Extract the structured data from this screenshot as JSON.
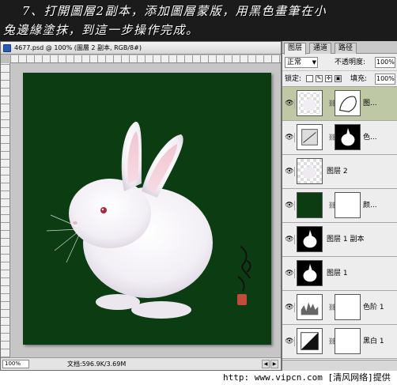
{
  "banner": {
    "line1": "7、打開圖層2副本，添加圖層蒙版，用黑色畫筆在小",
    "line2": "兔邊緣塗抹，到這一步操作完成。"
  },
  "document": {
    "title": "4677.psd @ 100% (圖層 2 副本, RGB/8#)",
    "zoom": "100%",
    "info": "文档:596.9K/3.69M",
    "canvas_color": "#0c3d12"
  },
  "panel": {
    "tabs": [
      "图层",
      "通道",
      "路径"
    ],
    "active_tab": "图层",
    "blend_mode": "正常",
    "opacity_label": "不透明度:",
    "opacity_value": "100%",
    "lock_label": "锁定:",
    "fill_label": "填充:",
    "fill_value": "100%",
    "layers": [
      {
        "name": "图...",
        "selected": true
      },
      {
        "name": "色..."
      },
      {
        "name": "图层 2"
      },
      {
        "name": "颜..."
      },
      {
        "name": "图层 1 副本"
      },
      {
        "name": "图层 1"
      },
      {
        "name": "色阶 1"
      },
      {
        "name": "黑白 1"
      }
    ]
  },
  "credit": "http: www.vipcn.com [清风网络]提供"
}
